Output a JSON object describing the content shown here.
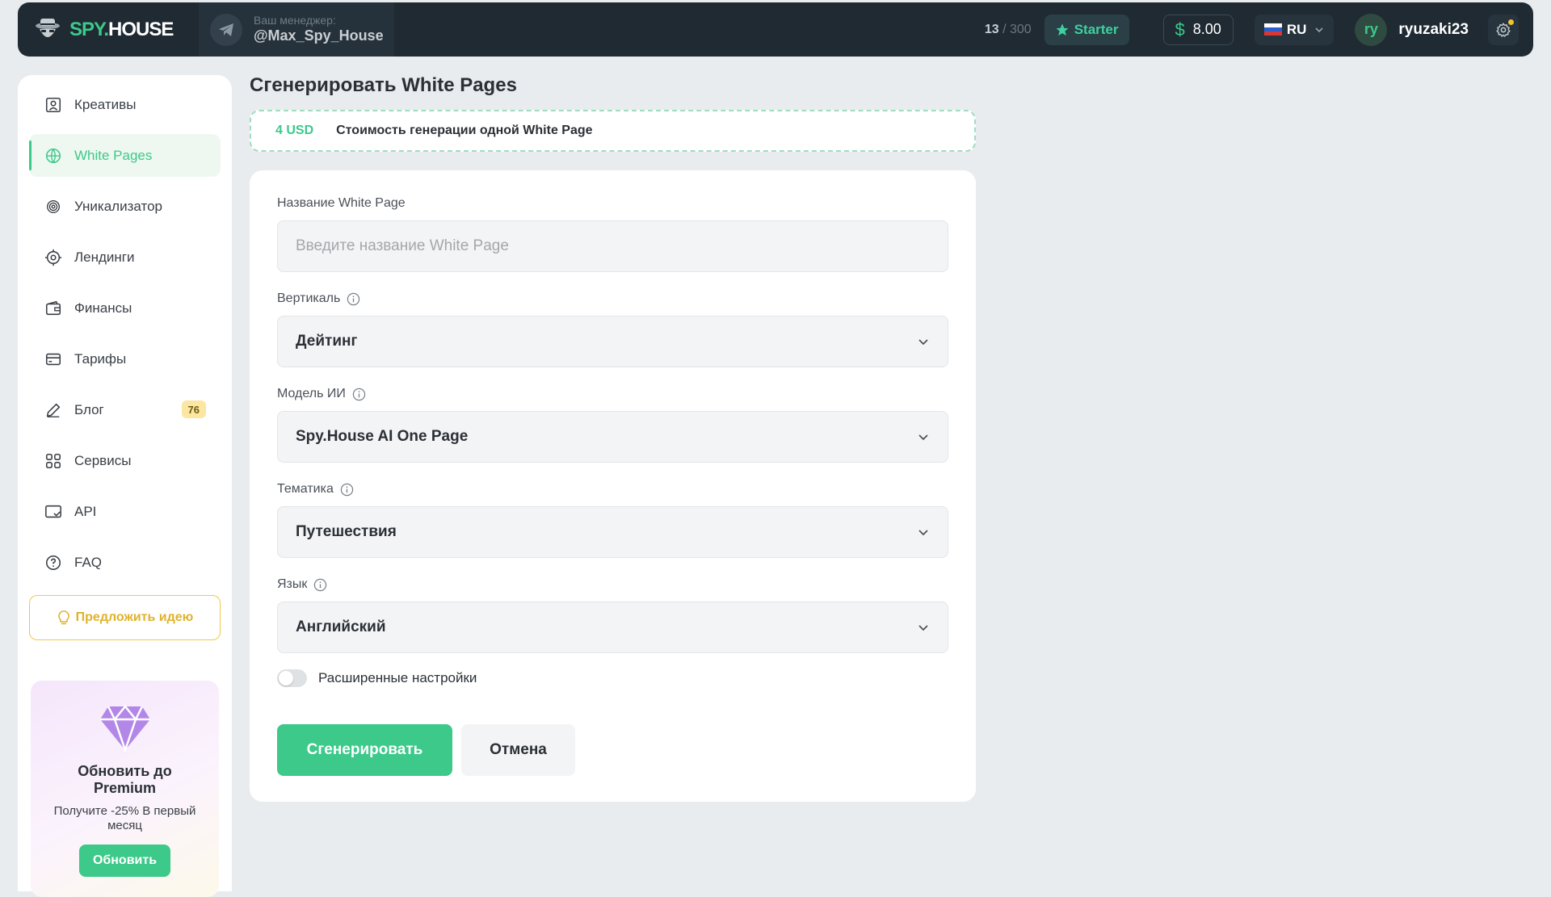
{
  "header": {
    "logo": {
      "spy": "SPY.",
      "house": "HOUSE"
    },
    "manager": {
      "caption": "Ваш менеджер:",
      "handle": "@Max_Spy_House"
    },
    "quota": {
      "used": "13",
      "total": "/ 300"
    },
    "plan_label": "Starter",
    "balance": "8.00",
    "language": "RU",
    "user": {
      "initials": "ry",
      "name": "ryuzaki23"
    }
  },
  "sidebar": {
    "items": [
      {
        "label": "Креативы",
        "icon": "creatives-icon"
      },
      {
        "label": "White Pages",
        "icon": "white-pages-icon",
        "active": true
      },
      {
        "label": "Уникализатор",
        "icon": "fingerprint-icon"
      },
      {
        "label": "Лендинги",
        "icon": "landing-icon"
      },
      {
        "label": "Финансы",
        "icon": "wallet-icon"
      },
      {
        "label": "Тарифы",
        "icon": "card-icon"
      },
      {
        "label": "Блог",
        "icon": "pen-icon",
        "badge": "76"
      },
      {
        "label": "Сервисы",
        "icon": "grid-icon"
      },
      {
        "label": "API",
        "icon": "api-icon"
      },
      {
        "label": "FAQ",
        "icon": "question-icon"
      }
    ],
    "idea_button": "Предложить идею",
    "promo": {
      "title": "Обновить до Premium",
      "text": "Получите -25% В первый месяц",
      "button": "Обновить"
    }
  },
  "main": {
    "title": "Сгенерировать White Pages",
    "cost": {
      "price": "4 USD",
      "label": "Стоимость генерации одной White Page"
    },
    "form": {
      "name_label": "Название White Page",
      "name_placeholder": "Введите название White Page",
      "vertical_label": "Вертикаль",
      "vertical_value": "Дейтинг",
      "model_label": "Модель ИИ",
      "model_value": "Spy.House AI One Page",
      "theme_label": "Тематика",
      "theme_value": "Путешествия",
      "language_label": "Язык",
      "language_value": "Английский",
      "advanced_label": "Расширенные настройки",
      "advanced_enabled": false,
      "generate_button": "Сгенерировать",
      "cancel_button": "Отмена"
    }
  },
  "colors": {
    "accent": "#3cc98a",
    "topbar": "#1f2a32",
    "background": "#e9ecee",
    "badge": "#fbe7a2",
    "idea": "#f1c84d"
  }
}
